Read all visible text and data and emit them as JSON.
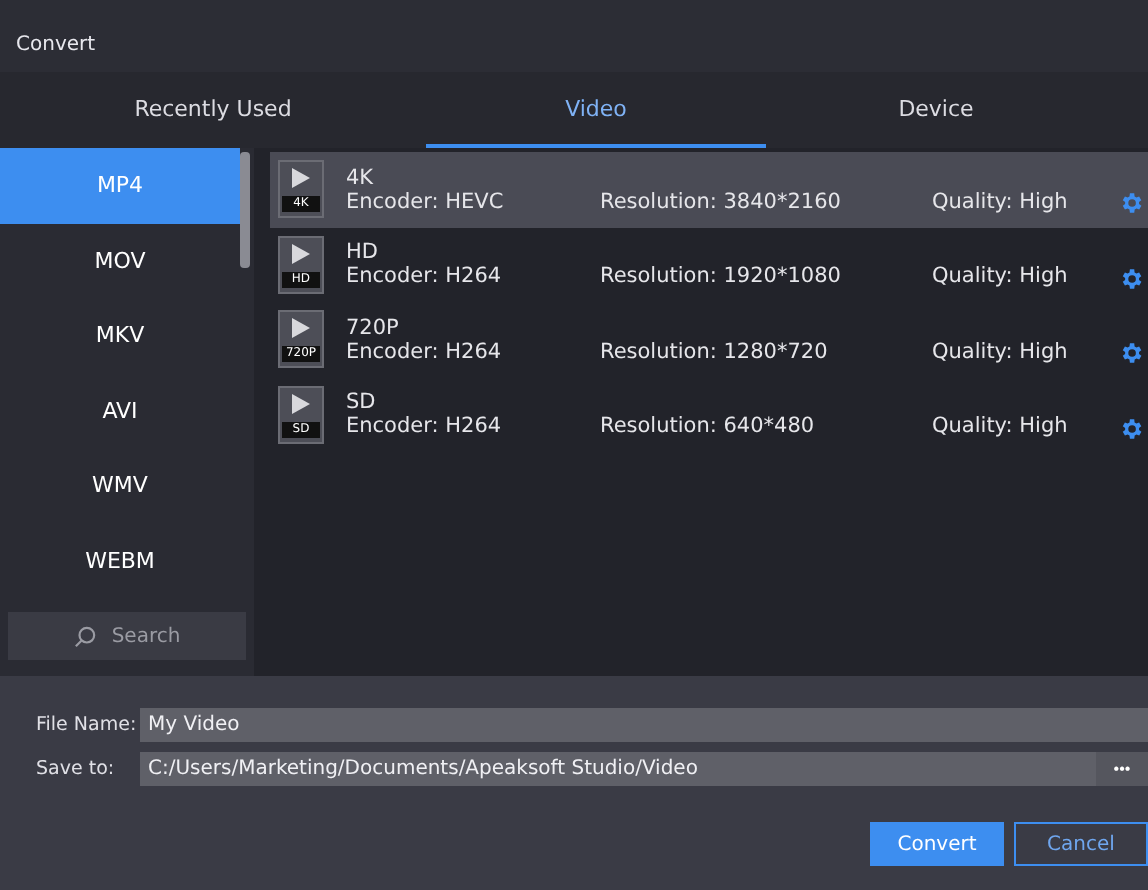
{
  "window": {
    "title": "Convert"
  },
  "tabs": [
    {
      "label": "Recently Used",
      "selected": false
    },
    {
      "label": "Video",
      "selected": true
    },
    {
      "label": "Device",
      "selected": false
    }
  ],
  "formats": [
    {
      "label": "MP4",
      "selected": true
    },
    {
      "label": "MOV",
      "selected": false
    },
    {
      "label": "MKV",
      "selected": false
    },
    {
      "label": "AVI",
      "selected": false
    },
    {
      "label": "WMV",
      "selected": false
    },
    {
      "label": "WEBM",
      "selected": false
    }
  ],
  "search": {
    "placeholder": "Search"
  },
  "presets": [
    {
      "name": "4K",
      "badge": "4K",
      "encoder": "Encoder: HEVC",
      "resolution": "Resolution: 3840*2160",
      "quality": "Quality: High",
      "selected": true
    },
    {
      "name": "HD",
      "badge": "HD",
      "encoder": "Encoder: H264",
      "resolution": "Resolution: 1920*1080",
      "quality": "Quality: High",
      "selected": false
    },
    {
      "name": "720P",
      "badge": "720P",
      "encoder": "Encoder: H264",
      "resolution": "Resolution: 1280*720",
      "quality": "Quality: High",
      "selected": false
    },
    {
      "name": "SD",
      "badge": "SD",
      "encoder": "Encoder: H264",
      "resolution": "Resolution: 640*480",
      "quality": "Quality: High",
      "selected": false
    }
  ],
  "file_name": {
    "label": "File Name:",
    "value": "My Video"
  },
  "save_to": {
    "label": "Save to:",
    "value": "C:/Users/Marketing/Documents/Apeaksoft Studio/Video",
    "browse": "•••"
  },
  "buttons": [
    {
      "label": "Convert",
      "kind": "primary"
    },
    {
      "label": "Cancel",
      "kind": "secondary"
    }
  ]
}
